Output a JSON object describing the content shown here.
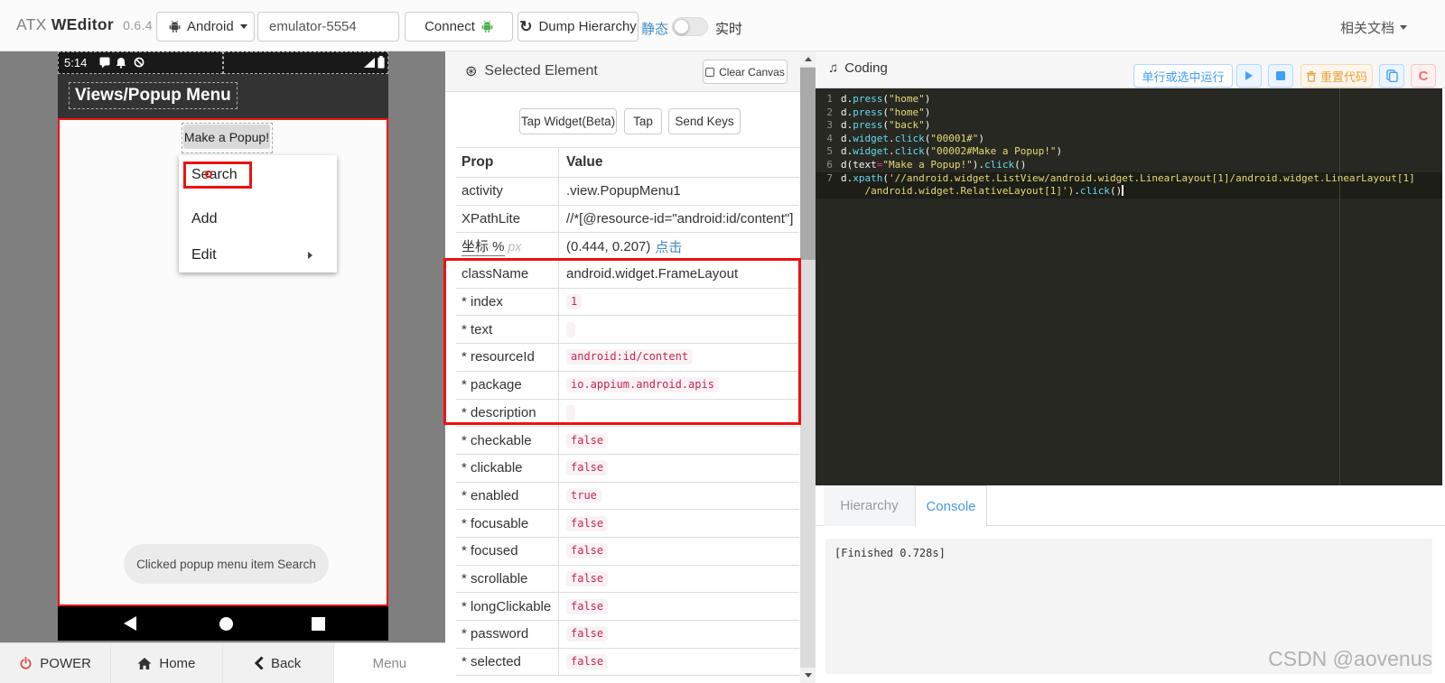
{
  "topbar": {
    "brand_prefix": "ATX",
    "brand_name": "WEditor",
    "brand_version": "0.6.4",
    "platform_select": {
      "label": "Android"
    },
    "device_input_value": "emulator-5554",
    "connect_label": "Connect",
    "dump_label": "Dump Hierarchy",
    "toggle_left": "静态",
    "toggle_right": "实时",
    "docs_label": "相关文档"
  },
  "phone": {
    "status_time": "5:14",
    "app_title": "Views/Popup Menu",
    "trigger_button": "Make a Popup!",
    "menu_items": [
      "Search",
      "Add",
      "Edit"
    ],
    "toast": "Clicked popup menu item Search"
  },
  "footer": {
    "power": "POWER",
    "home": "Home",
    "back": "Back",
    "menu": "Menu"
  },
  "inspector": {
    "title": "Selected Element",
    "clear_canvas": "Clear Canvas",
    "action_buttons": [
      "Tap Widget(Beta)",
      "Tap",
      "Send Keys"
    ],
    "col_prop": "Prop",
    "col_value": "Value",
    "rows": [
      {
        "key": "activity",
        "label": "activity",
        "value": ".view.PopupMenu1",
        "type": "text"
      },
      {
        "key": "xpathlite",
        "label": "XPathLite",
        "value": "//*[@resource-id=\"android:id/content\"]",
        "type": "text"
      },
      {
        "key": "coords",
        "label": "坐标 %",
        "label_suffix": "px",
        "value": "(0.444, 0.207)",
        "link": "点击",
        "type": "coords"
      },
      {
        "key": "className",
        "label": "className",
        "value": "android.widget.FrameLayout",
        "type": "text"
      },
      {
        "key": "index",
        "label": "* index",
        "value": "1",
        "type": "code"
      },
      {
        "key": "text",
        "label": "* text",
        "value": "",
        "type": "code"
      },
      {
        "key": "resourceId",
        "label": "* resourceId",
        "value": "android:id/content",
        "type": "code"
      },
      {
        "key": "package",
        "label": "* package",
        "value": "io.appium.android.apis",
        "type": "code"
      },
      {
        "key": "description",
        "label": "* description",
        "value": "",
        "type": "code"
      },
      {
        "key": "checkable",
        "label": "* checkable",
        "value": "false",
        "type": "code"
      },
      {
        "key": "clickable",
        "label": "* clickable",
        "value": "false",
        "type": "code"
      },
      {
        "key": "enabled",
        "label": "* enabled",
        "value": "true",
        "type": "code"
      },
      {
        "key": "focusable",
        "label": "* focusable",
        "value": "false",
        "type": "code"
      },
      {
        "key": "focused",
        "label": "* focused",
        "value": "false",
        "type": "code"
      },
      {
        "key": "scrollable",
        "label": "* scrollable",
        "value": "false",
        "type": "code"
      },
      {
        "key": "longClickable",
        "label": "* longClickable",
        "value": "false",
        "type": "code"
      },
      {
        "key": "password",
        "label": "* password",
        "value": "false",
        "type": "code"
      },
      {
        "key": "selected",
        "label": "* selected",
        "value": "false",
        "type": "code"
      }
    ],
    "highlighted_rows": [
      "className",
      "index",
      "text",
      "resourceId",
      "package",
      "description"
    ]
  },
  "coding": {
    "title": "Coding",
    "run_selection_label": "单行或选中运行",
    "reset_label": "重置代码",
    "lines": [
      {
        "num": 1,
        "rows": [
          [
            [
              "d",
              "w"
            ],
            [
              ".",
              "w"
            ],
            [
              "press",
              "b"
            ],
            [
              "(",
              "w"
            ],
            [
              "\"home\"",
              "s"
            ],
            [
              ")",
              "w"
            ]
          ]
        ]
      },
      {
        "num": 2,
        "rows": [
          [
            [
              "d",
              "w"
            ],
            [
              ".",
              "w"
            ],
            [
              "press",
              "b"
            ],
            [
              "(",
              "w"
            ],
            [
              "\"home\"",
              "s"
            ],
            [
              ")",
              "w"
            ]
          ]
        ]
      },
      {
        "num": 3,
        "rows": [
          [
            [
              "d",
              "w"
            ],
            [
              ".",
              "w"
            ],
            [
              "press",
              "b"
            ],
            [
              "(",
              "w"
            ],
            [
              "\"back\"",
              "s"
            ],
            [
              ")",
              "w"
            ]
          ]
        ]
      },
      {
        "num": 4,
        "rows": [
          [
            [
              "d",
              "w"
            ],
            [
              ".",
              "w"
            ],
            [
              "widget",
              "b"
            ],
            [
              ".",
              "w"
            ],
            [
              "click",
              "b"
            ],
            [
              "(",
              "w"
            ],
            [
              "\"00001#\"",
              "s"
            ],
            [
              ")",
              "w"
            ]
          ]
        ]
      },
      {
        "num": 5,
        "rows": [
          [
            [
              "d",
              "w"
            ],
            [
              ".",
              "w"
            ],
            [
              "widget",
              "b"
            ],
            [
              ".",
              "w"
            ],
            [
              "click",
              "b"
            ],
            [
              "(",
              "w"
            ],
            [
              "\"00002#Make a Popup!\"",
              "s"
            ],
            [
              ")",
              "w"
            ]
          ]
        ]
      },
      {
        "num": 6,
        "rows": [
          [
            [
              "d(",
              "w"
            ],
            [
              "text",
              "w"
            ],
            [
              "=",
              "p"
            ],
            [
              "\"Make a Popup!\"",
              "s"
            ],
            [
              ")",
              "w"
            ],
            [
              ".",
              "w"
            ],
            [
              "click",
              "b"
            ],
            [
              "()",
              "w"
            ]
          ]
        ]
      },
      {
        "num": 7,
        "active": true,
        "cursor": true,
        "rows": [
          [
            [
              "d",
              "w"
            ],
            [
              ".",
              "w"
            ],
            [
              "xpath",
              "b"
            ],
            [
              "(",
              "w"
            ],
            [
              "'//android.widget.ListView/android.widget.LinearLayout[1]/android.widget.LinearLayout[1]",
              "s"
            ]
          ],
          [
            [
              "    /android.widget.RelativeLayout[1]')",
              "s"
            ],
            [
              ".",
              "w"
            ],
            [
              "click",
              "b"
            ],
            [
              "()",
              "w"
            ]
          ]
        ]
      }
    ]
  },
  "tabs": {
    "hierarchy": "Hierarchy",
    "console": "Console"
  },
  "console_output": "[Finished 0.728s]",
  "watermark": "CSDN @aovenus",
  "colors": {
    "highlight_red": "#ee1111",
    "link_blue": "#428bca",
    "element_blue": "#409eff",
    "element_orange": "#e6a23c",
    "element_red": "#f56c6c",
    "code_bg": "#272822",
    "code_string": "#e6db74",
    "code_builtin": "#66d9ef",
    "code_operator": "#f92672",
    "chip_fg": "#c7254e",
    "chip_bg": "#f9f2f4"
  }
}
